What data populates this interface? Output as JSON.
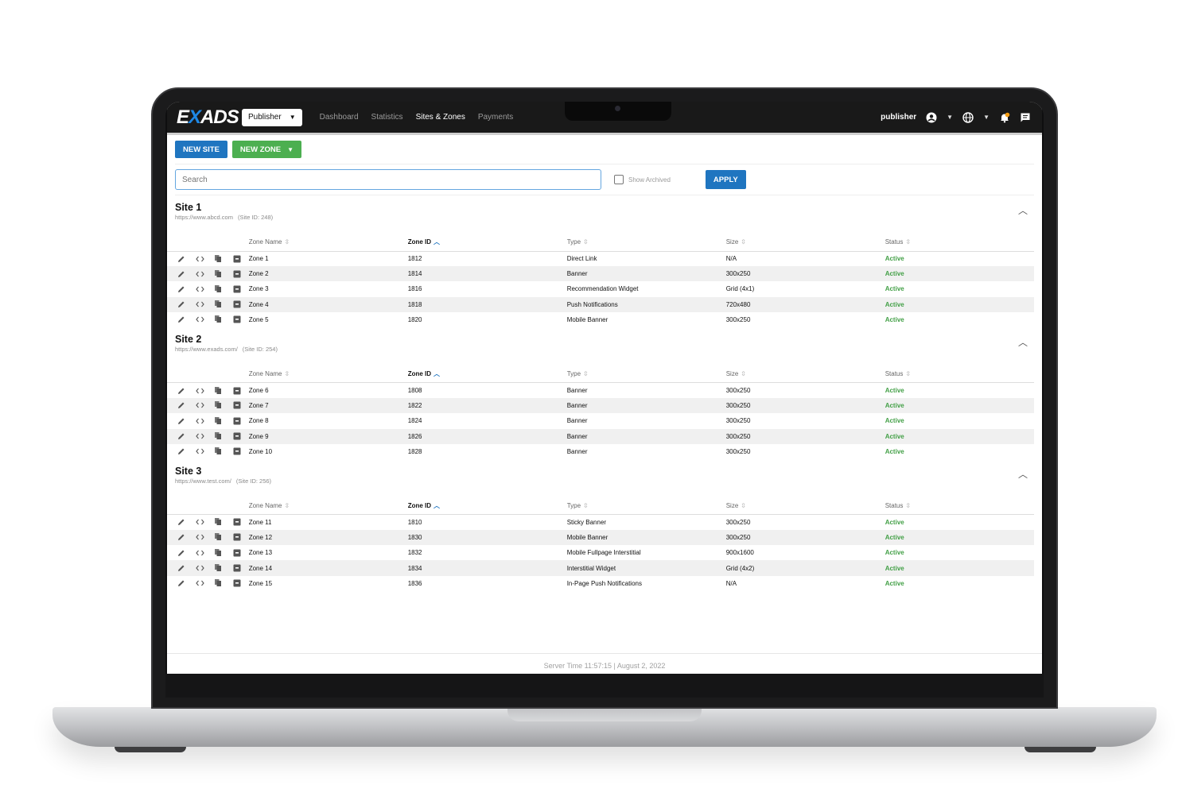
{
  "navbar": {
    "logo_text": "EXADS",
    "role_select": "Publisher",
    "links": [
      {
        "label": "Dashboard",
        "active": false
      },
      {
        "label": "Statistics",
        "active": false
      },
      {
        "label": "Sites & Zones",
        "active": true
      },
      {
        "label": "Payments",
        "active": false
      }
    ],
    "username": "publisher",
    "notification_badge_color": "#f39c12"
  },
  "toolbar": {
    "new_site_label": "NEW SITE",
    "new_zone_label": "NEW ZONE"
  },
  "filter": {
    "search_placeholder": "Search",
    "show_archived_label": "Show Archived",
    "apply_label": "APPLY"
  },
  "table_headers": {
    "zone_name": "Zone Name",
    "zone_id": "Zone ID",
    "type": "Type",
    "size": "Size",
    "status": "Status"
  },
  "sites": [
    {
      "name": "Site 1",
      "url": "https://www.abcd.com",
      "site_id": "(Site ID: 248)",
      "zones": [
        {
          "name": "Zone 1",
          "id": "1812",
          "type": "Direct Link",
          "size": "N/A",
          "status": "Active"
        },
        {
          "name": "Zone 2",
          "id": "1814",
          "type": "Banner",
          "size": "300x250",
          "status": "Active"
        },
        {
          "name": "Zone 3",
          "id": "1816",
          "type": "Recommendation Widget",
          "size": "Grid (4x1)",
          "status": "Active"
        },
        {
          "name": "Zone 4",
          "id": "1818",
          "type": "Push Notifications",
          "size": "720x480",
          "status": "Active"
        },
        {
          "name": "Zone 5",
          "id": "1820",
          "type": "Mobile Banner",
          "size": "300x250",
          "status": "Active"
        }
      ]
    },
    {
      "name": "Site 2",
      "url": "https://www.exads.com/",
      "site_id": "(Site ID: 254)",
      "zones": [
        {
          "name": "Zone 6",
          "id": "1808",
          "type": "Banner",
          "size": "300x250",
          "status": "Active"
        },
        {
          "name": "Zone 7",
          "id": "1822",
          "type": "Banner",
          "size": "300x250",
          "status": "Active"
        },
        {
          "name": "Zone 8",
          "id": "1824",
          "type": "Banner",
          "size": "300x250",
          "status": "Active"
        },
        {
          "name": "Zone 9",
          "id": "1826",
          "type": "Banner",
          "size": "300x250",
          "status": "Active"
        },
        {
          "name": "Zone 10",
          "id": "1828",
          "type": "Banner",
          "size": "300x250",
          "status": "Active"
        }
      ]
    },
    {
      "name": "Site 3",
      "url": "https://www.test.com/",
      "site_id": "(Site ID: 256)",
      "zones": [
        {
          "name": "Zone 11",
          "id": "1810",
          "type": "Sticky Banner",
          "size": "300x250",
          "status": "Active"
        },
        {
          "name": "Zone 12",
          "id": "1830",
          "type": "Mobile Banner",
          "size": "300x250",
          "status": "Active"
        },
        {
          "name": "Zone 13",
          "id": "1832",
          "type": "Mobile Fullpage Interstitial",
          "size": "900x1600",
          "status": "Active"
        },
        {
          "name": "Zone 14",
          "id": "1834",
          "type": "Interstitial Widget",
          "size": "Grid (4x2)",
          "status": "Active"
        },
        {
          "name": "Zone 15",
          "id": "1836",
          "type": "In-Page Push Notifications",
          "size": "N/A",
          "status": "Active"
        }
      ]
    }
  ],
  "footer": {
    "server_time": "Server Time 11:57:15 | August 2, 2022"
  },
  "colors": {
    "brand_blue": "#1f75c0",
    "brand_green": "#4caf50",
    "status_active": "#43a047"
  }
}
